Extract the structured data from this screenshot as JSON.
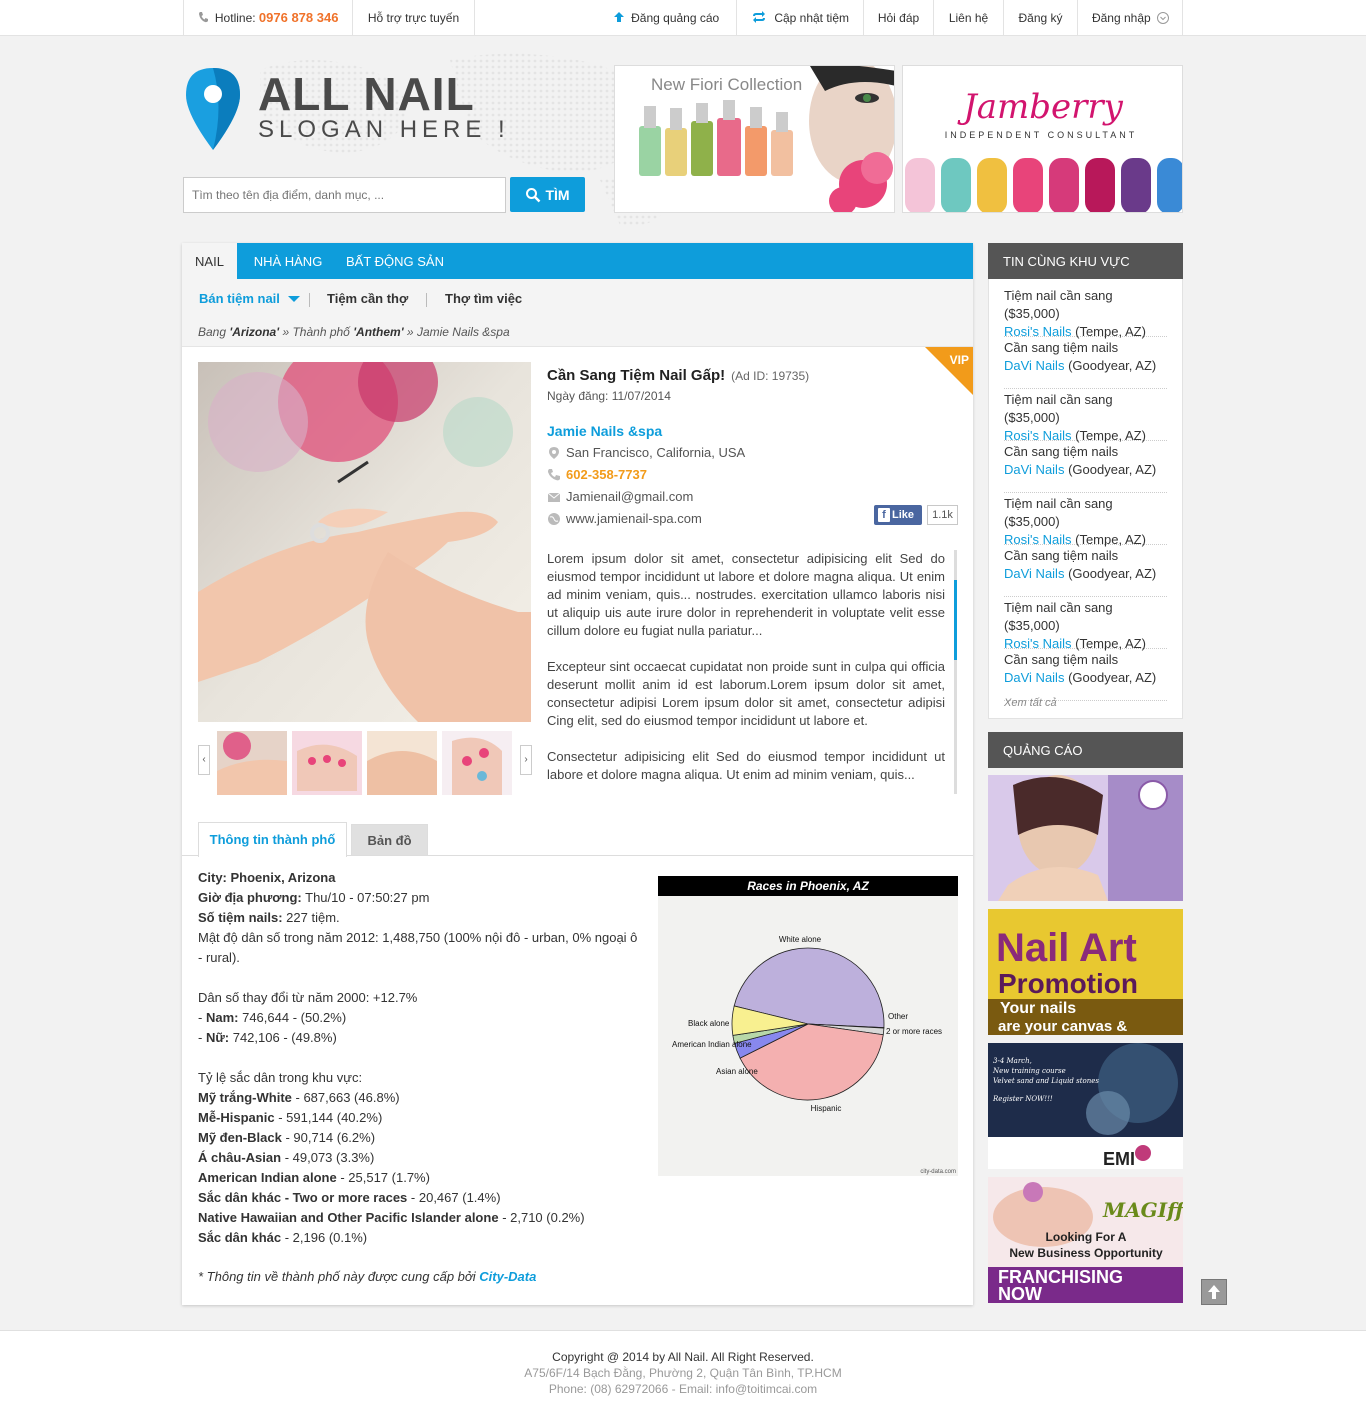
{
  "topbar": {
    "hotline_label": "Hotline:",
    "hotline_number": "0976 878 346",
    "support": "Hỗ trợ trực tuyến",
    "post_ad": "Đăng quảng cáo",
    "update_shop": "Cập nhật tiệm",
    "faq": "Hỏi đáp",
    "contact": "Liên hệ",
    "register": "Đăng ký",
    "login": "Đăng nhập"
  },
  "logo": {
    "title": "ALL NAIL",
    "slogan": "SLOGAN HERE !"
  },
  "search": {
    "placeholder": "Tìm theo tên địa điểm, danh mục, ...",
    "button": "TÌM"
  },
  "banners": {
    "left_text": "New Fiori Collection",
    "right_brand": "Jamberry",
    "right_sub": "INDEPENDENT CONSULTANT"
  },
  "tabs": [
    "NAIL",
    "NHÀ HÀNG",
    "BẤT ĐỘNG SẢN"
  ],
  "subnav": [
    "Bán tiệm nail",
    "Tiệm cần thợ",
    "Thợ tìm việc"
  ],
  "breadcrumb": {
    "p1": "Bang",
    "state": "'Arizona'",
    "sep1": "»",
    "p2": "Thành phố",
    "city": "'Anthem'",
    "sep2": "»",
    "shop": "Jamie Nails &spa"
  },
  "listing": {
    "vip": "VIP",
    "title": "Cần Sang Tiệm Nail Gấp!",
    "ad_id": "(Ad ID: 19735)",
    "date": "Ngày đăng: 11/07/2014",
    "shop_name": "Jamie Nails &spa",
    "address": "San Francisco, California, USA",
    "phone": "602-358-7737",
    "email": "Jamienail@gmail.com",
    "website": "www.jamienail-spa.com",
    "like": "Like",
    "like_count": "1.1k",
    "desc": [
      "Lorem ipsum dolor sit amet, consectetur adipisicing elit Sed do eiusmod tempor incididunt ut labore et dolore magna aliqua. Ut enim ad minim veniam, quis... nostrudes. exercitation ullamco laboris nisi ut aliquip uis aute irure dolor in reprehenderit in voluptate velit esse cillum dolore eu fugiat nulla pariatur...",
      "Excepteur sint occaecat cupidatat non proide sunt in culpa qui officia deserunt mollit anim id est laborum.Lorem ipsum dolor sit amet, consectetur adipisi Lorem ipsum dolor sit amet, consectetur adipisi Cing elit, sed do eiusmod tempor incididunt ut labore et.",
      "Consectetur adipisicing elit Sed do eiusmod tempor incididunt ut labore et dolore magna aliqua. Ut enim ad minim veniam, quis..."
    ]
  },
  "content_tabs": [
    "Thông tin thành phố",
    "Bản đồ"
  ],
  "city_info": {
    "city": "City: Phoenix, Arizona",
    "local_time_label": "Giờ địa phương:",
    "local_time": "Thu/10 - 07:50:27 pm",
    "shops_label": "Số tiệm nails:",
    "shops": "227 tiệm.",
    "density": "Mật độ dân số trong năm 2012: 1,488,750 (100% nội đô - urban, 0% ngoại ô - rural).",
    "change": "Dân số thay đổi từ năm 2000: +12.7%",
    "male_label": "Nam:",
    "male": "746,644 - (50.2%)",
    "female_label": "Nữ:",
    "female": "742,106 - (49.8%)",
    "races_title": "Tỷ lệ sắc dân trong khu vực:",
    "races": [
      {
        "label": "Mỹ trắng-White",
        "value": "- 687,663 (46.8%)"
      },
      {
        "label": "Mễ-Hispanic",
        "value": "- 591,144 (40.2%)"
      },
      {
        "label": "Mỹ đen-Black",
        "value": "- 90,714 (6.2%)"
      },
      {
        "label": "Á châu-Asian",
        "value": "- 49,073 (3.3%)"
      },
      {
        "label": "American Indian alone",
        "value": "- 25,517 (1.7%)"
      },
      {
        "label": "Sắc dân khác - Two or more races",
        "value": "- 20,467 (1.4%)"
      },
      {
        "label": "Native Hawaiian and Other Pacific Islander alone",
        "value": "- 2,710 (0.2%)"
      },
      {
        "label": "Sắc dân khác",
        "value": "- 2,196 (0.1%)"
      }
    ],
    "note": "* Thông tin về thành phố này được cung cấp bởi",
    "note_link": "City-Data"
  },
  "chart_data": {
    "type": "pie",
    "title": "Races in Phoenix, AZ",
    "source": "city-data.com",
    "slices": [
      {
        "label": "White alone",
        "value": 46.8,
        "color": "#bdb0dc"
      },
      {
        "label": "Other",
        "value": 0.1,
        "color": "#e8e0c8"
      },
      {
        "label": "2 or more races",
        "value": 1.4,
        "color": "#d8d8d8"
      },
      {
        "label": "Hispanic",
        "value": 40.2,
        "color": "#f4b0b0"
      },
      {
        "label": "Asian alone",
        "value": 3.3,
        "color": "#8888ee"
      },
      {
        "label": "American Indian alone",
        "value": 1.7,
        "color": "#b8d8a8"
      },
      {
        "label": "Black alone",
        "value": 6.2,
        "color": "#f8f090"
      }
    ]
  },
  "sidebar": {
    "news_title": "TIN CÙNG KHU VỰC",
    "news": [
      {
        "title": "Tiệm nail cần sang ($35,000)",
        "shop": "Rosi's Nails",
        "loc": "(Tempe, AZ)"
      },
      {
        "title": "Cần sang tiệm nails",
        "shop": "DaVi Nails",
        "loc": "(Goodyear, AZ)"
      },
      {
        "title": "Tiệm nail cần sang ($35,000)",
        "shop": "Rosi's Nails",
        "loc": "(Tempe, AZ)"
      },
      {
        "title": "Cần sang tiệm nails",
        "shop": "DaVi Nails",
        "loc": "(Goodyear, AZ)"
      },
      {
        "title": "Tiệm nail cần sang ($35,000)",
        "shop": "Rosi's Nails",
        "loc": "(Tempe, AZ)"
      },
      {
        "title": "Cần sang tiệm nails",
        "shop": "DaVi Nails",
        "loc": "(Goodyear, AZ)"
      },
      {
        "title": "Tiệm nail cần sang ($35,000)",
        "shop": "Rosi's Nails",
        "loc": "(Tempe, AZ)"
      },
      {
        "title": "Cần sang tiệm nails",
        "shop": "DaVi Nails",
        "loc": "(Goodyear, AZ)"
      }
    ],
    "see_all": "Xem tất cả",
    "ads_title": "QUẢNG CÁO",
    "ad2_line1": "Nail Art",
    "ad2_line2": "Promotion",
    "ad2_line3": "Your nails",
    "ad2_line4": "are your canvas &",
    "ad3_line1": "3-4 March,",
    "ad3_line2": "New training course",
    "ad3_line3": "Velvet sand and Liquid stones",
    "ad3_line4": "Register NOW!!!",
    "ad3_brand": "EMI",
    "ad4_brand": "MAGIff",
    "ad4_line1": "Looking For A",
    "ad4_line2": "New Business Opportunity",
    "ad4_line3": "FRANCHISING",
    "ad4_line4": "NOW"
  },
  "footer": {
    "copyright": "Copyright @ 2014 by All Nail. All Right Reserved.",
    "address": "A75/6F/14 Bạch Đằng, Phường 2, Quận Tân Bình, TP.HCM",
    "phone": "Phone: (08) 62972066 - Email: info@toitimcai.com"
  }
}
